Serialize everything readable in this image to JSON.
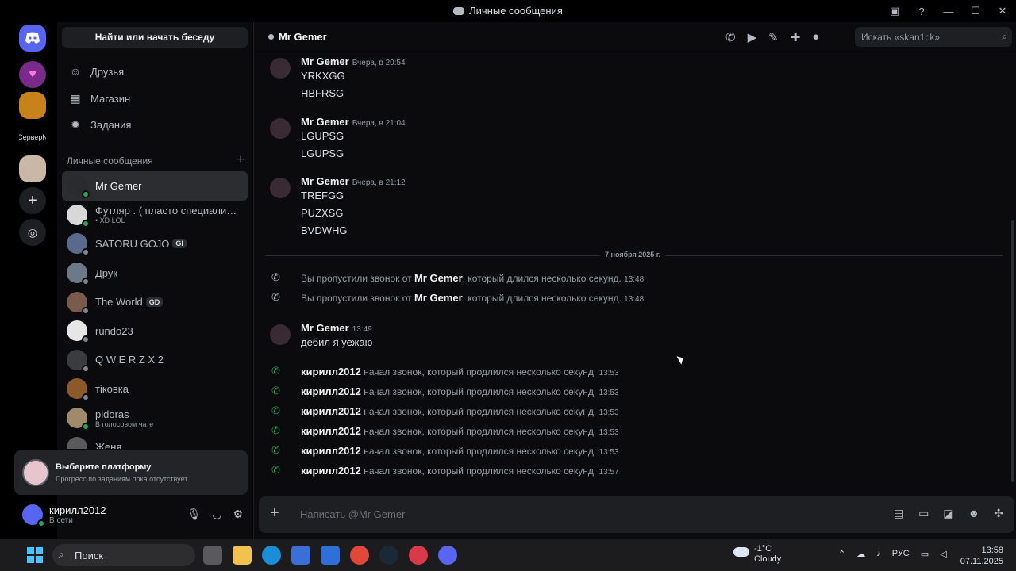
{
  "window": {
    "title": "Личные сообщения"
  },
  "rail": {
    "server_label": "СерверN"
  },
  "sidebar": {
    "search_button": "Найти или начать беседу",
    "nav": [
      {
        "label": "Друзья",
        "icon": "friends-icon"
      },
      {
        "label": "Магазин",
        "icon": "shop-icon"
      },
      {
        "label": "Задания",
        "icon": "quests-icon"
      }
    ],
    "dm_header": "Личные сообщения",
    "dms": [
      {
        "name": "Mr Gemer",
        "sub": "",
        "tag": "",
        "active": true,
        "status": "online",
        "color": "#2a2b2f"
      },
      {
        "name": "Футляр . ( пласто специалис...",
        "sub": "• XD LOL",
        "tag": "",
        "active": false,
        "status": "online",
        "color": "#d8d8d8"
      },
      {
        "name": "SATORU GOJO",
        "sub": "",
        "tag": "GI",
        "active": false,
        "status": "offline",
        "color": "#5a6a8a"
      },
      {
        "name": "Друк",
        "sub": "",
        "tag": "",
        "active": false,
        "status": "offline",
        "color": "#6b7a86"
      },
      {
        "name": "The World",
        "sub": "",
        "tag": "GD",
        "active": false,
        "status": "offline",
        "color": "#7a5a4a"
      },
      {
        "name": "rundo23",
        "sub": "",
        "tag": "",
        "active": false,
        "status": "offline",
        "color": "#e6e6e6"
      },
      {
        "name": "Q W E R Z X 2",
        "sub": "",
        "tag": "",
        "active": false,
        "status": "offline",
        "color": "#3a3c40"
      },
      {
        "name": "тiковка",
        "sub": "",
        "tag": "",
        "active": false,
        "status": "offline",
        "color": "#8a5a2a"
      },
      {
        "name": "pidoras",
        "sub": "В голосовом чате",
        "tag": "",
        "active": false,
        "status": "online",
        "color": "#a08a6a"
      },
      {
        "name": "Женя",
        "sub": "",
        "tag": "",
        "active": false,
        "status": "offline",
        "color": "#5a5a5a"
      }
    ],
    "quest": {
      "title": "Выберите платформу",
      "subtitle": "Прогресс по заданиям пока отсутствует"
    },
    "user": {
      "name": "кирилл2012",
      "status": "В сети"
    }
  },
  "chat": {
    "recipient": "Mr Gemer",
    "search_placeholder": "Искать «skan1ck»",
    "divider": "7 ноября 2025 г.",
    "groups": [
      {
        "author": "Mr Gemer",
        "time": "Вчера, в 20:54",
        "lines": [
          "YRKXGG",
          "HBFRSG"
        ]
      },
      {
        "author": "Mr Gemer",
        "time": "Вчера, в 21:04",
        "lines": [
          "LGUPSG",
          "LGUPSG"
        ]
      },
      {
        "author": "Mr Gemer",
        "time": "Вчера, в 21:12",
        "lines": [
          "TREFGG",
          "PUZXSG",
          "BVDWHG"
        ]
      }
    ],
    "missed_calls": [
      {
        "pre": "Вы пропустили звонок от",
        "who": "Mr Gemer",
        "post": ", который длился несколько секунд.",
        "time": "13:48"
      },
      {
        "pre": "Вы пропустили звонок от",
        "who": "Mr Gemer",
        "post": ", который длился несколько секунд.",
        "time": "13:48"
      }
    ],
    "last_message": {
      "author": "Mr Gemer",
      "time": "13:49",
      "text": "дебил я уежаю"
    },
    "calls": [
      {
        "who": "кирилл2012",
        "text": "начал звонок, который продлился несколько секунд.",
        "time": "13:53"
      },
      {
        "who": "кирилл2012",
        "text": "начал звонок, который продлился несколько секунд.",
        "time": "13:53"
      },
      {
        "who": "кирилл2012",
        "text": "начал звонок, который продлился несколько секунд.",
        "time": "13:53"
      },
      {
        "who": "кирилл2012",
        "text": "начал звонок, который продлился несколько секунд.",
        "time": "13:53"
      },
      {
        "who": "кирилл2012",
        "text": "начал звонок, который продлился несколько секунд.",
        "time": "13:53"
      },
      {
        "who": "кирилл2012",
        "text": "начал звонок, который продлился несколько секунд.",
        "time": "13:57"
      }
    ],
    "composer_placeholder": "Написать @Mr Gemer"
  },
  "taskbar": {
    "search": "Поиск",
    "weather_temp": "-1°C",
    "weather_desc": "Cloudy",
    "lang": "РУС",
    "time": "13:58",
    "date": "07.11.2025"
  },
  "colors": {
    "accent": "#5865f2",
    "online": "#23a55a",
    "bg": "#0b0b0d"
  }
}
